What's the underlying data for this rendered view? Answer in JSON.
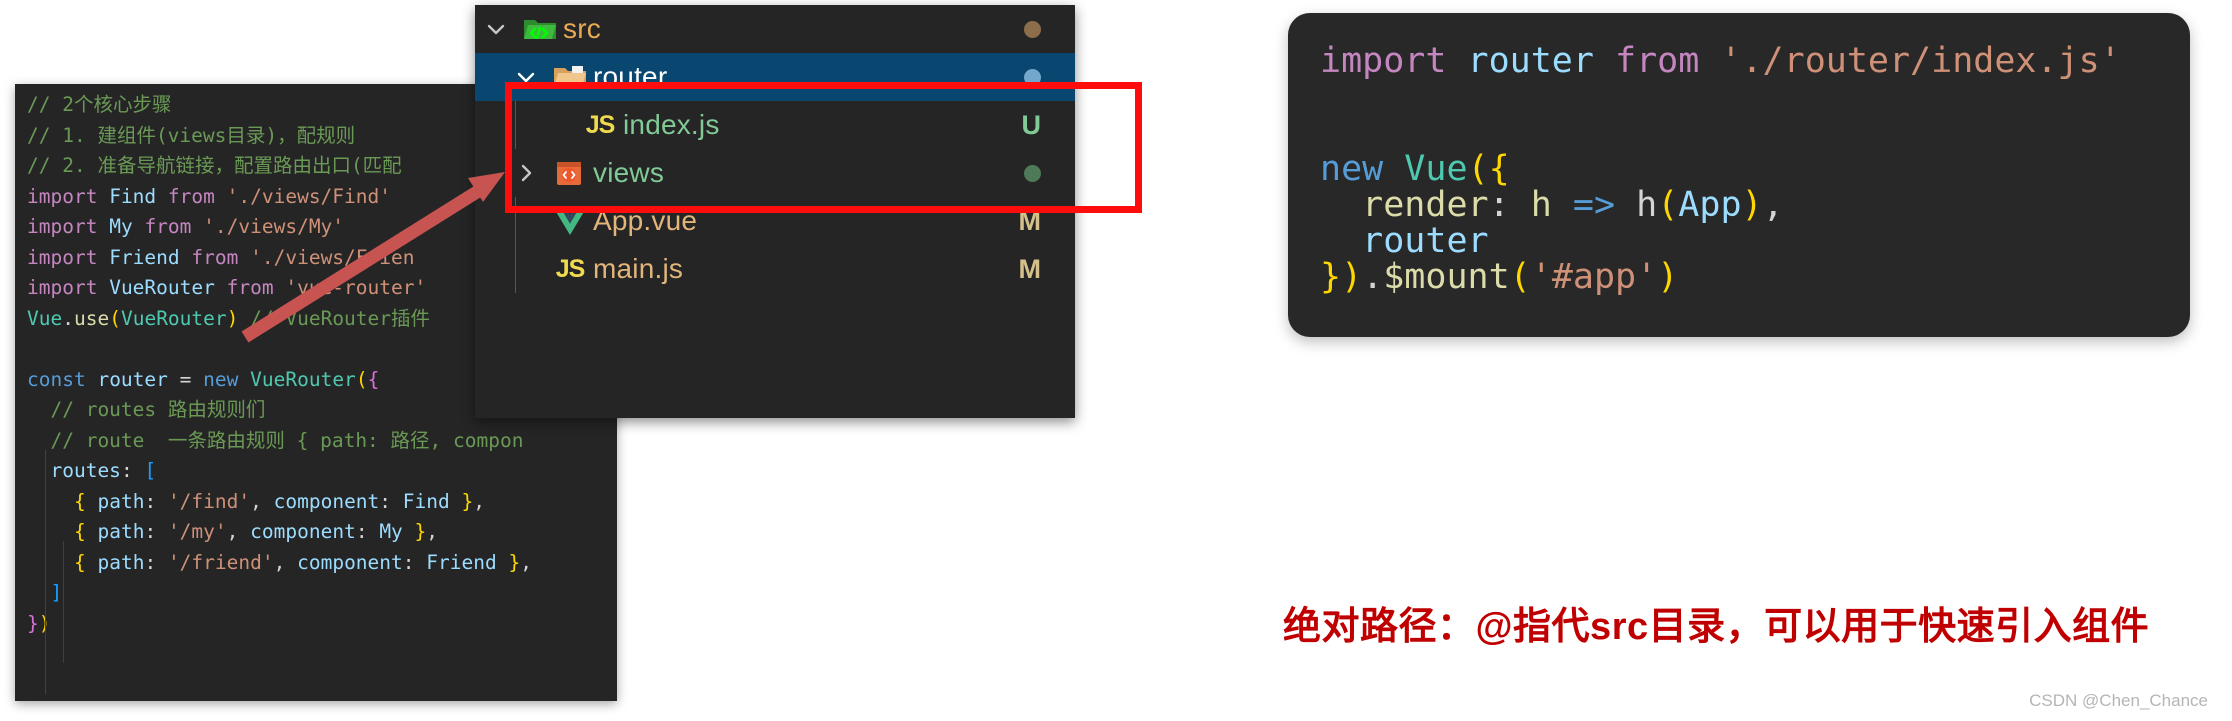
{
  "left_editor": {
    "name": "router-index-source",
    "lines": [
      {
        "id": "l1",
        "text": "// 2个核心步骤"
      },
      {
        "id": "l2",
        "text": "// 1. 建组件(views目录)，配规则"
      },
      {
        "id": "l3",
        "text": "// 2. 准备导航链接，配置路由出口(匹配"
      },
      {
        "id": "l4",
        "text": "import Find from './views/Find'"
      },
      {
        "id": "l5",
        "text": "import My from './views/My'"
      },
      {
        "id": "l6",
        "text": "import Friend from './views/Frien"
      },
      {
        "id": "l7",
        "text": "import VueRouter from 'vue-router'"
      },
      {
        "id": "l8",
        "text": "Vue.use(VueRouter) // VueRouter插件"
      },
      {
        "id": "l9",
        "text": ""
      },
      {
        "id": "l10",
        "text": "const router = new VueRouter({"
      },
      {
        "id": "l11",
        "text": "  // routes 路由规则们"
      },
      {
        "id": "l12",
        "text": "  // route  一条路由规则 { path: 路径, compon"
      },
      {
        "id": "l13",
        "text": "  routes: ["
      },
      {
        "id": "l14",
        "text": "    { path: '/find', component: Find },"
      },
      {
        "id": "l15",
        "text": "    { path: '/my', component: My },"
      },
      {
        "id": "l16",
        "text": "    { path: '/friend', component: Friend },"
      },
      {
        "id": "l17",
        "text": "  ]"
      },
      {
        "id": "l18",
        "text": "})"
      }
    ]
  },
  "file_tree": {
    "title": "src",
    "rows": [
      {
        "label": "src",
        "chevron": "chevron-down",
        "icon": "folder-src-open-icon",
        "label_color": "#E8AB53",
        "badge": "",
        "dot": "#8C6E4B",
        "selected": false,
        "indent": 0,
        "icon_kind": "src-folder"
      },
      {
        "label": "router",
        "chevron": "chevron-down",
        "icon": "folder-open-icon",
        "label_color": "#FFFFFF",
        "badge": "",
        "dot": "#73A7CC",
        "selected": true,
        "indent": 1,
        "icon_kind": "folder"
      },
      {
        "label": "index.js",
        "chevron": "",
        "icon": "js-file-icon",
        "label_color": "#81C995",
        "badge": "U",
        "badge_color": "#81C995",
        "dot": "",
        "selected": false,
        "indent": 2,
        "icon_kind": "js"
      },
      {
        "label": "views",
        "chevron": "chevron-right",
        "icon": "folder-views-icon",
        "label_color": "#81C995",
        "badge": "",
        "dot": "#4E7A58",
        "selected": false,
        "indent": 1,
        "icon_kind": "views-folder"
      },
      {
        "label": "App.vue",
        "chevron": "",
        "icon": "vue-file-icon",
        "label_color": "#E2B579",
        "badge": "M",
        "badge_color": "#D3C08A",
        "dot": "",
        "selected": false,
        "indent": 1,
        "icon_kind": "vue"
      },
      {
        "label": "main.js",
        "chevron": "",
        "icon": "js-file-icon",
        "label_color": "#E2B579",
        "badge": "M",
        "badge_color": "#D3C08A",
        "dot": "",
        "selected": false,
        "indent": 1,
        "icon_kind": "js"
      }
    ]
  },
  "right_editor": {
    "name": "main-js-source",
    "lines": [
      {
        "id": "r1",
        "text": "import router from './router/index.js'"
      },
      {
        "id": "r2",
        "text": ""
      },
      {
        "id": "r3",
        "text": "new Vue({"
      },
      {
        "id": "r4",
        "text": "  render: h => h(App),"
      },
      {
        "id": "r5",
        "text": "  router"
      },
      {
        "id": "r6",
        "text": "}).$mount('#app')"
      }
    ]
  },
  "annotation": {
    "note_text": "绝对路径：@指代src目录，可以用于快速引入组件",
    "note_color": "#C00000",
    "highlight_box_color": "#FF0D0D",
    "arrow_color": "#C75450"
  },
  "watermark": {
    "text": "CSDN @Chen_Chance"
  }
}
